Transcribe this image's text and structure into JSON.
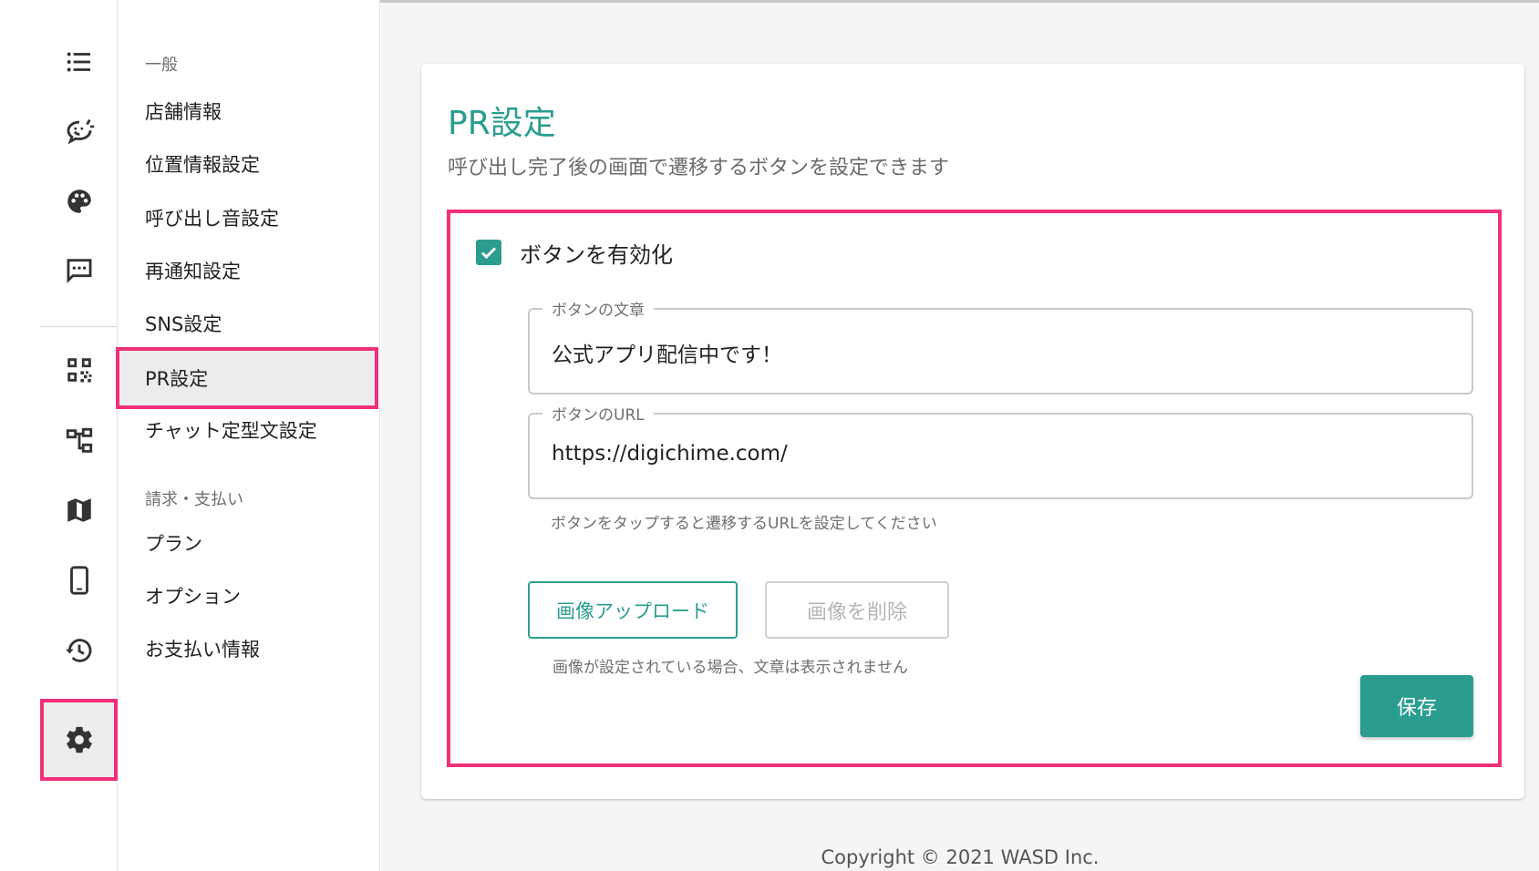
{
  "rail": {
    "icons": [
      "list-icon",
      "chat-smile-icon",
      "palette-icon",
      "message-icon",
      "qr-code-icon",
      "hierarchy-icon",
      "map-icon",
      "smartphone-icon",
      "history-icon",
      "gear-icon"
    ]
  },
  "menu": {
    "section_general": "一般",
    "items_general": [
      "店舗情報",
      "位置情報設定",
      "呼び出し音設定",
      "再通知設定",
      "SNS設定",
      "PR設定",
      "チャット定型文設定"
    ],
    "section_billing": "請求・支払い",
    "items_billing": [
      "プラン",
      "オプション",
      "お支払い情報"
    ]
  },
  "card": {
    "title": "PR設定",
    "subtitle": "呼び出し完了後の画面で遷移するボタンを設定できます",
    "enable_label": "ボタンを有効化",
    "enable_checked": true,
    "text_field": {
      "label": "ボタンの文章",
      "value": "公式アプリ配信中です！"
    },
    "url_field": {
      "label": "ボタンのURL",
      "value": "https://digichime.com/",
      "helper": "ボタンをタップすると遷移するURLを設定してください"
    },
    "upload_label": "画像アップロード",
    "delete_label": "画像を削除",
    "image_note": "画像が設定されている場合、文章は表示されません",
    "save_label": "保存"
  },
  "footer": {
    "copyright": "Copyright © 2021 WASD Inc."
  },
  "colors": {
    "accent": "#2a9d8f",
    "highlight": "#f0307a"
  }
}
